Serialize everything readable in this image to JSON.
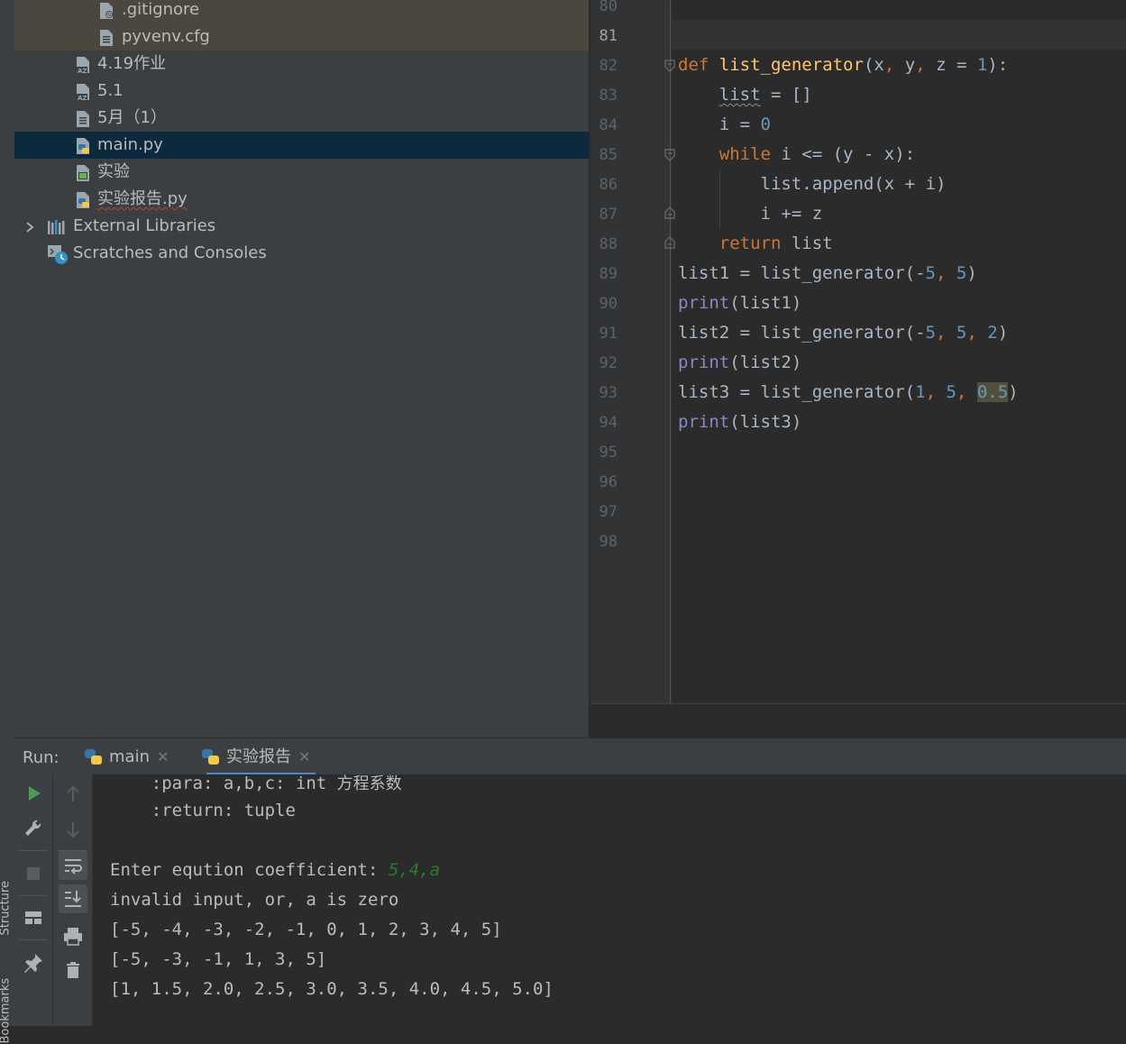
{
  "side_strip": {
    "structure_label": "Structure",
    "bookmarks_label": "Bookmarks"
  },
  "project_tree": {
    "items": [
      {
        "label": ".gitignore",
        "icon": "gitignore-file-icon"
      },
      {
        "label": "pyvenv.cfg",
        "icon": "text-file-icon"
      },
      {
        "label": "4.19作业",
        "icon": "text-file-icon"
      },
      {
        "label": "5.1",
        "icon": "text-file-icon"
      },
      {
        "label": "5月（1）",
        "icon": "text-file-icon"
      },
      {
        "label": "main.py",
        "icon": "python-file-icon"
      },
      {
        "label": "实验",
        "icon": "notebook-file-icon"
      },
      {
        "label": "实验报告.py",
        "icon": "python-file-icon"
      },
      {
        "label": "External Libraries",
        "icon": "library-icon"
      },
      {
        "label": "Scratches and Consoles",
        "icon": "scratches-icon"
      }
    ]
  },
  "editor": {
    "line_numbers": [
      "80",
      "81",
      "82",
      "83",
      "84",
      "85",
      "86",
      "87",
      "88",
      "89",
      "90",
      "91",
      "92",
      "93",
      "94",
      "95",
      "96",
      "97",
      "98"
    ],
    "current_line": "81",
    "code_lines": [
      "",
      "",
      "def list_generator(x, y, z = 1):",
      "    list = []",
      "    i = 0",
      "    while i <= (y - x):",
      "        list.append(x + i)",
      "        i += z",
      "    return list",
      "list1 = list_generator(-5, 5)",
      "print(list1)",
      "list2 = list_generator(-5, 5, 2)",
      "print(list2)",
      "list3 = list_generator(1, 5, 0.5)",
      "print(list3)",
      "",
      "",
      "",
      ""
    ]
  },
  "run_panel": {
    "title": "Run:",
    "tabs": [
      {
        "label": "main",
        "active": false
      },
      {
        "label": "实验报告",
        "active": true
      }
    ],
    "console": {
      "doc_para_prefix": "    :para: a,b,c: int ",
      "doc_para_comment": "方程系数",
      "doc_return": "    :return: tuple",
      "prompt": "Enter eqution coefficient: ",
      "user_input": "5,4,a",
      "error": "invalid input, or, a is zero",
      "output1": "[-5, -4, -3, -2, -1, 0, 1, 2, 3, 4, 5]",
      "output2": "[-5, -3, -1, 1, 3, 5]",
      "output3": "[1, 1.5, 2.0, 2.5, 3.0, 3.5, 4.0, 4.5, 5.0]"
    }
  },
  "colors": {
    "keyword": "#cc7832",
    "function": "#ffc66d",
    "number": "#6897bb",
    "builtin": "#8888c6",
    "user_input": "#287e28",
    "selection": "#0d293e",
    "run_icon": "#499c54"
  }
}
